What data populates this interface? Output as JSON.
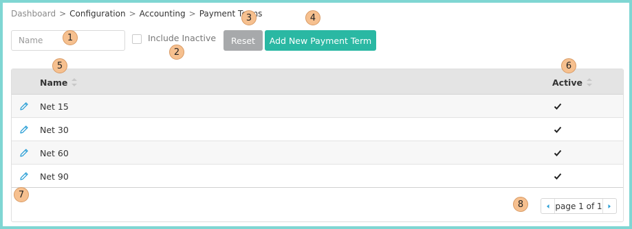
{
  "breadcrumb": [
    "Dashboard",
    "Configuration",
    "Accounting",
    "Payment Terms"
  ],
  "breadcrumb_separator": ">",
  "filter": {
    "name_placeholder": "Name",
    "name_value": "",
    "include_inactive_label": "Include Inactive",
    "include_inactive_checked": false
  },
  "buttons": {
    "reset": "Reset",
    "add": "Add New Payment Term"
  },
  "table": {
    "columns": {
      "name": "Name",
      "active": "Active"
    },
    "rows": [
      {
        "name": "Net 15",
        "active": true
      },
      {
        "name": "Net 30",
        "active": true
      },
      {
        "name": "Net 60",
        "active": true
      },
      {
        "name": "Net 90",
        "active": true
      }
    ]
  },
  "pagination": {
    "text": "page 1 of 1"
  },
  "annotations": [
    "1",
    "2",
    "3",
    "4",
    "5",
    "6",
    "7",
    "8"
  ],
  "colors": {
    "accent": "#2ab8a3",
    "reset_button": "#a7a9ab",
    "icon_blue": "#2b9fd6",
    "annotation": "#f6c08f",
    "border": "#7fd6d3"
  }
}
